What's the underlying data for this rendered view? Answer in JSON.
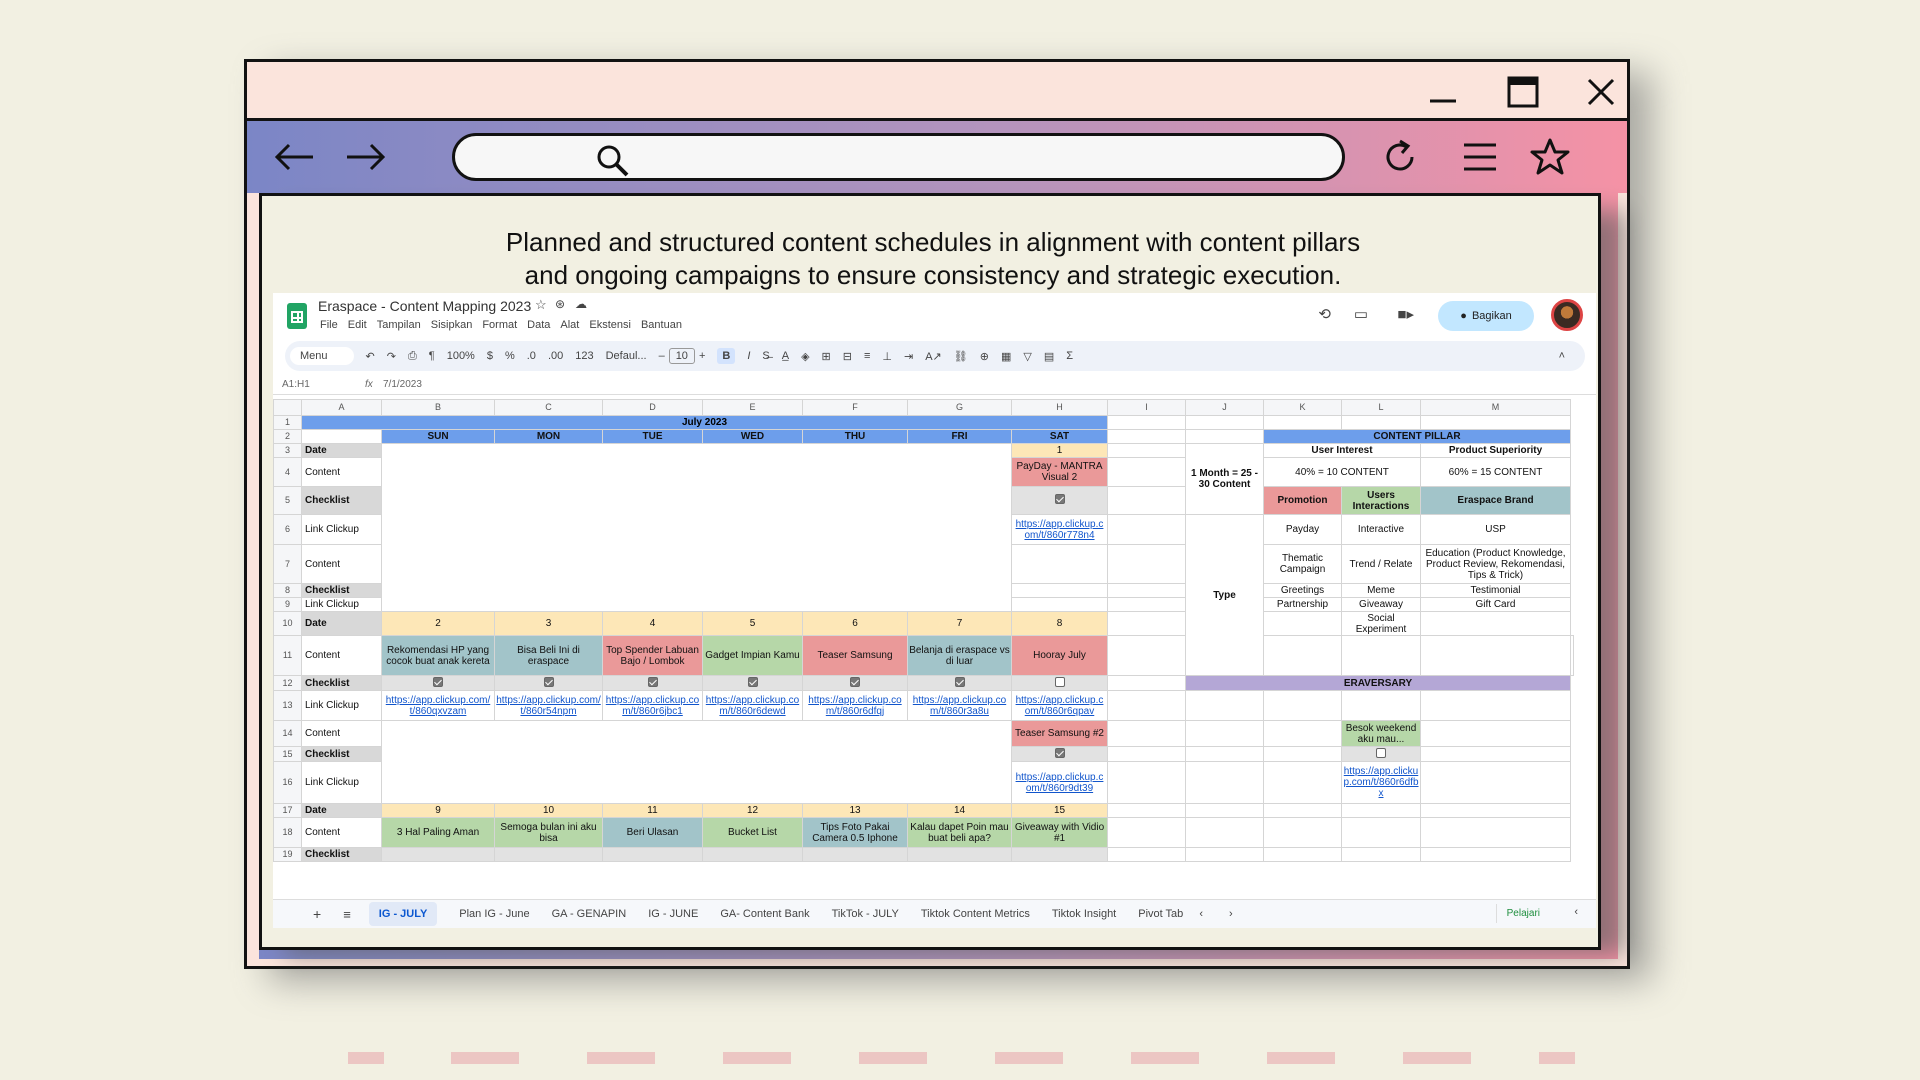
{
  "browser": {
    "window_controls": {
      "minimize": "minimize-icon",
      "maximize": "maximize-icon",
      "close": "close-icon"
    },
    "nav": {
      "back": "arrow-left-icon",
      "forward": "arrow-right-icon",
      "reload": "reload-icon",
      "menu": "hamburger-icon",
      "bookmark": "star-icon"
    },
    "address_bar": {
      "value": "",
      "icon": "search-icon"
    }
  },
  "caption": {
    "line1": "Planned and structured content schedules in alignment with content pillars",
    "line2": "and ongoing campaigns to ensure consistency and strategic execution."
  },
  "sheet": {
    "doc_title": "Eraspace - Content Mapping 2023",
    "menu": [
      "File",
      "Edit",
      "Tampilan",
      "Sisipkan",
      "Format",
      "Data",
      "Alat",
      "Ekstensi",
      "Bantuan"
    ],
    "share_label": "Bagikan",
    "toolbar": {
      "search": "Menu",
      "zoom": "100%",
      "currency": "$",
      "percent": "%",
      "dec1": ".0",
      "dec2": ".00",
      "num": "123",
      "font": "Defaul...",
      "size": "10",
      "bold": "B",
      "italic": "I"
    },
    "cell_ref": "A1:H1",
    "formula": "7/1/2023",
    "columns": [
      "A",
      "B",
      "C",
      "D",
      "E",
      "F",
      "G",
      "H",
      "I",
      "J",
      "K",
      "L",
      "M"
    ],
    "rows": [
      "1",
      "2",
      "3",
      "4",
      "5",
      "6",
      "7",
      "8",
      "9",
      "10",
      "11",
      "12",
      "13",
      "14",
      "15",
      "16",
      "17",
      "18",
      "19"
    ],
    "month_title": "July 2023",
    "days": [
      "SUN",
      "MON",
      "TUE",
      "WED",
      "THU",
      "FRI",
      "SAT"
    ],
    "labels": {
      "date": "Date",
      "content": "Content",
      "checklist": "Checklist",
      "link": "Link Clickup"
    },
    "week1": {
      "sat_date": "1",
      "sat_content": "PayDay - MANTRA Visual 2",
      "sat_link": "https://app.clickup.com/t/860r778n4"
    },
    "week2": {
      "dates": [
        "2",
        "3",
        "4",
        "5",
        "6",
        "7",
        "8"
      ],
      "content": [
        "Rekomendasi HP yang cocok buat anak kereta",
        "Bisa Beli Ini di eraspace",
        "Top Spender Labuan Bajo / Lombok",
        "Gadget Impian Kamu",
        "Teaser Samsung",
        "Belanja di eraspace vs di luar",
        "Hooray July"
      ],
      "links": [
        "https://app.clickup.com/t/860qxvzam",
        "https://app.clickup.com/t/860r54npm",
        "https://app.clickup.com/t/860r6jbc1",
        "https://app.clickup.com/t/860r6dewd",
        "https://app.clickup.com/t/860r6dfqj",
        "https://app.clickup.com/t/860r3a8u",
        "https://app.clickup.com/t/860r6qpav"
      ],
      "sat_content2": "Teaser Samsung #2",
      "sat_link2": "https://app.clickup.com/t/860r9dt39"
    },
    "week3": {
      "dates": [
        "9",
        "10",
        "11",
        "12",
        "13",
        "14",
        "15"
      ],
      "content": [
        "3 Hal Paling Aman",
        "Semoga bulan ini aku bisa",
        "Beri Ulasan",
        "Bucket List",
        "Tips Foto Pakai Camera 0.5 Iphone",
        "Kalau dapet Poin mau buat beli apa?",
        "Giveaway with Vidio #1"
      ]
    },
    "pillar": {
      "title": "CONTENT PILLAR",
      "user_interest": "User Interest",
      "product_superiority": "Product Superiority",
      "month_note": "1 Month = 25 - 30 Content",
      "pct40": "40% = 10 CONTENT",
      "pct60": "60% = 15 CONTENT",
      "promotion": "Promotion",
      "users_interactions": "Users Interactions",
      "eraspace_brand": "Eraspace Brand",
      "type": "Type",
      "k": [
        "Payday",
        "Thematic Campaign",
        "Greetings",
        "Partnership",
        ""
      ],
      "l": [
        "Interactive",
        "Trend / Relate",
        "Meme",
        "Giveaway",
        "Social Experiment"
      ],
      "m": [
        "USP",
        "Education (Product Knowledge, Product Review, Rekomendasi, Tips & Trick)",
        "Testimonial",
        "Gift Card",
        ""
      ]
    },
    "eraversary": {
      "title": "ERAVERSARY",
      "content": "Besok weekend aku mau...",
      "link": "https://app.clickup.com/t/860r6dfbx"
    },
    "tabs": [
      "IG - JULY",
      "Plan IG - June",
      "GA - GENAPIN",
      "IG - JUNE",
      "GA- Content Bank",
      "TikTok - JULY",
      "Tiktok Content Metrics",
      "Tiktok Insight",
      "Pivot Tab"
    ],
    "learn": "Pelajari"
  }
}
